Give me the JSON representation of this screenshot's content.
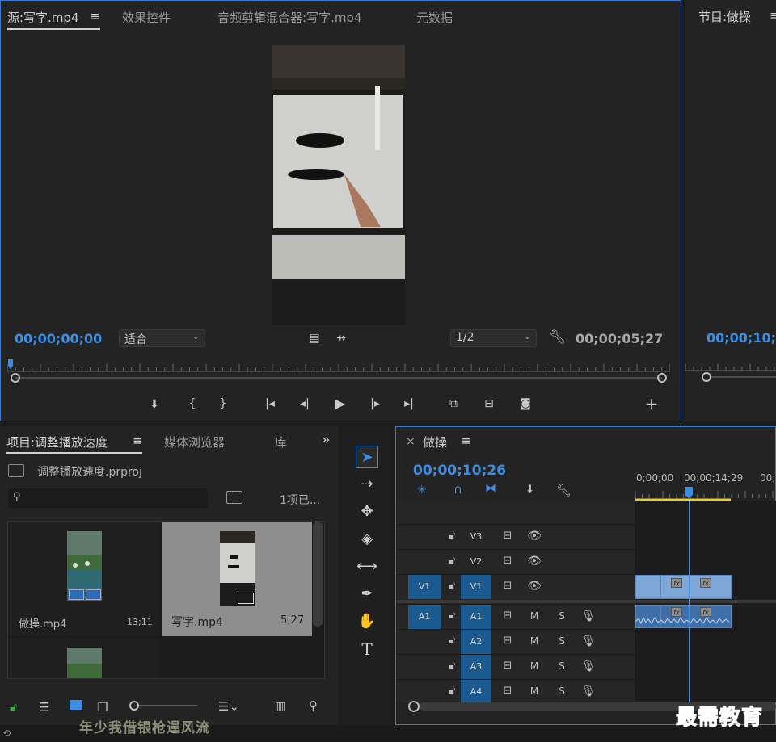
{
  "source_panel": {
    "tabs": [
      "源:写字.mp4",
      "效果控件",
      "音频剪辑混合器:写字.mp4",
      "元数据"
    ],
    "menu_glyph": "≡",
    "timecode_current": "00;00;00;00",
    "fit_dropdown": "适合",
    "resolution_dropdown": "1/2",
    "timecode_duration": "00;00;05;27"
  },
  "program_panel": {
    "tab": "节目:做操",
    "menu_glyph": "≡",
    "timecode_current": "00;00;10;2"
  },
  "project_panel": {
    "tabs": [
      "项目:调整播放速度",
      "媒体浏览器",
      "库"
    ],
    "menu_glyph": "≡",
    "overflow_glyph": "»",
    "project_file": "调整播放速度.prproj",
    "item_count": "1项已...",
    "items": [
      {
        "name": "做操.mp4",
        "duration": "13;11"
      },
      {
        "name": "写字.mp4",
        "duration": "5;27"
      }
    ]
  },
  "timeline_panel": {
    "close_glyph": "×",
    "sequence_name": "做操",
    "menu_glyph": "≡",
    "timecode": "00;00;10;26",
    "ruler_labels": [
      "0;00;00",
      "00;00;14;29",
      "00;"
    ],
    "video_tracks": [
      {
        "src": "",
        "label": "V3"
      },
      {
        "src": "",
        "label": "V2"
      },
      {
        "src": "V1",
        "label": "V1"
      }
    ],
    "audio_tracks": [
      {
        "src": "A1",
        "label": "A1"
      },
      {
        "src": "",
        "label": "A2"
      },
      {
        "src": "",
        "label": "A3"
      },
      {
        "src": "",
        "label": "A4"
      }
    ],
    "mute_label": "M",
    "solo_label": "S",
    "fx_label": "fx"
  },
  "watermarks": {
    "left": "年少我借银枪逞风流",
    "right": "最需教育"
  },
  "colors": {
    "accent_blue": "#3d8ee3",
    "playhead_yellow": "#e8d01a",
    "clip_blue": "#7fa7d8",
    "target_blue": "#1b5a8f"
  }
}
